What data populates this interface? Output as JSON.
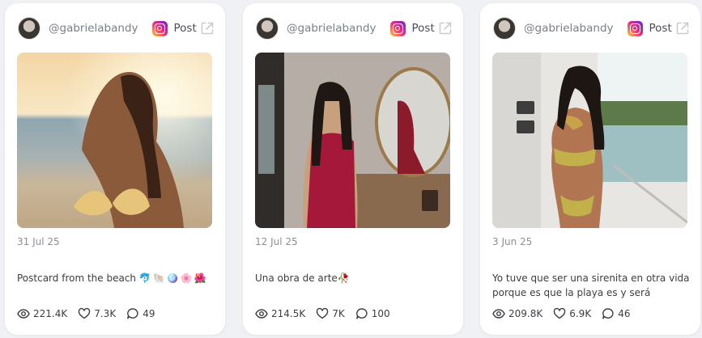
{
  "colors": {
    "text_muted": "#7b7f87",
    "text_main": "#3b3e45",
    "card_bg": "#ffffff",
    "page_bg": "#f0f1f4"
  },
  "posts": [
    {
      "handle": "@gabrielabandy",
      "platform_icon": "instagram-icon",
      "type_label": "Post",
      "date": "31 Jul 25",
      "caption": "Postcard from the beach",
      "caption_emoji": "🐬🐚🪩🌸🌺",
      "stats": {
        "views": "221.4K",
        "likes": "7.3K",
        "comments": "49"
      }
    },
    {
      "handle": "@gabrielabandy",
      "platform_icon": "instagram-icon",
      "type_label": "Post",
      "date": "12 Jul 25",
      "caption": "Una obra de arte",
      "caption_emoji": "🥀",
      "stats": {
        "views": "214.5K",
        "likes": "7K",
        "comments": "100"
      }
    },
    {
      "handle": "@gabrielabandy",
      "platform_icon": "instagram-icon",
      "type_label": "Post",
      "date": "3 Jun 25",
      "caption": "Yo tuve que ser una sirenita en otra vida porque es que la playa es y será siempr...",
      "caption_emoji": "",
      "stats": {
        "views": "209.8K",
        "likes": "6.9K",
        "comments": "46"
      }
    }
  ]
}
